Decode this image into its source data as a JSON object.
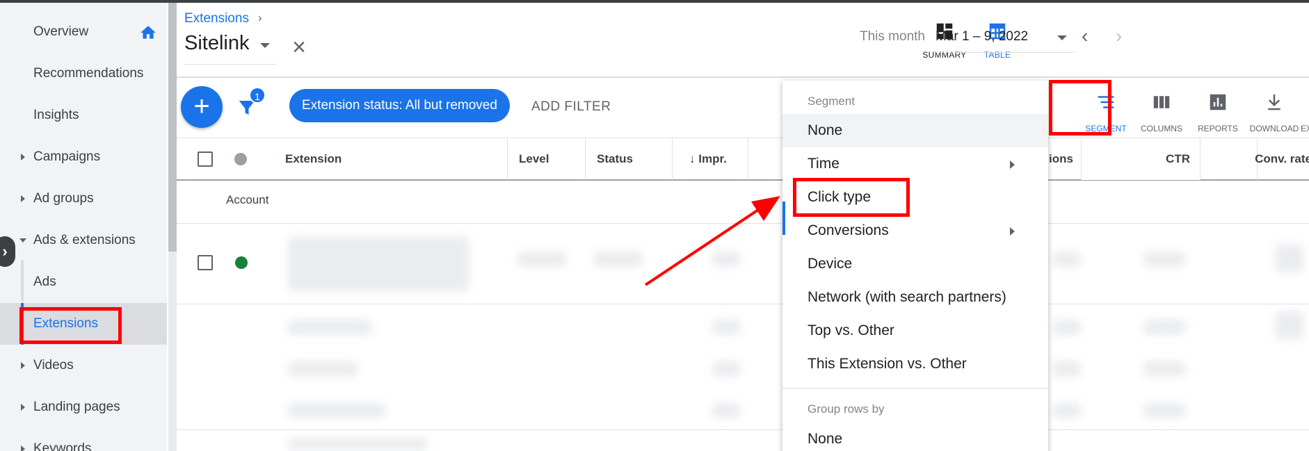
{
  "sidebar": {
    "items": [
      {
        "label": "Overview"
      },
      {
        "label": "Recommendations"
      },
      {
        "label": "Insights"
      },
      {
        "label": "Campaigns"
      },
      {
        "label": "Ad groups"
      },
      {
        "label": "Ads & extensions"
      },
      {
        "label": "Ads"
      },
      {
        "label": "Extensions"
      },
      {
        "label": "Videos"
      },
      {
        "label": "Landing pages"
      },
      {
        "label": "Keywords"
      }
    ]
  },
  "header": {
    "breadcrumb": "Extensions",
    "title": "Sitelink",
    "summary_label": "SUMMARY",
    "table_label": "TABLE",
    "this_month": "This month",
    "date_range": "Mar 1 – 9, 2022"
  },
  "toolbar": {
    "filter_count": "1",
    "status_chip": "Extension status: All but removed",
    "add_filter": "ADD FILTER",
    "segment": "SEGMENT",
    "columns": "COLUMNS",
    "reports": "REPORTS",
    "download": "DOWNLOAD",
    "expand": "EXPAN"
  },
  "table": {
    "headers": {
      "extension": "Extension",
      "level": "Level",
      "status": "Status",
      "impr": "Impr.",
      "conversions": "ions",
      "ctr": "CTR",
      "conv_rate": "Conv. rate"
    },
    "account_row": "Account"
  },
  "menu": {
    "segment_title": "Segment",
    "segment_items": [
      "None",
      "Time",
      "Click type",
      "Conversions",
      "Device",
      "Network (with search partners)",
      "Top vs. Other",
      "This Extension vs. Other"
    ],
    "group_title": "Group rows by",
    "group_items": [
      "None"
    ]
  },
  "colors": {
    "accent": "#1a73e8",
    "annotation": "#ff0000",
    "status_enabled": "#188038"
  }
}
